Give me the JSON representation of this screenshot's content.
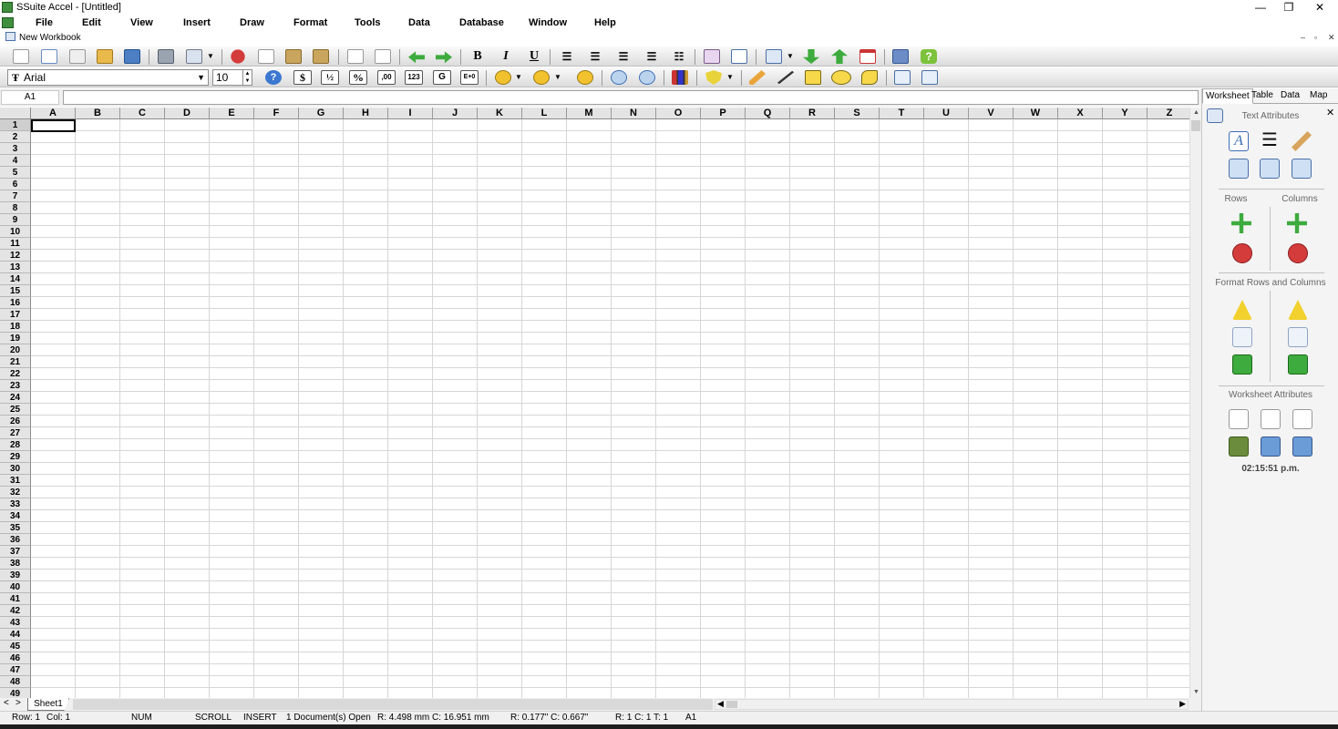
{
  "window": {
    "title": "SSuite Accel - [Untitled]",
    "controls": [
      "—",
      "❐",
      "✕"
    ]
  },
  "menu": [
    "File",
    "Edit",
    "View",
    "Insert",
    "Draw",
    "Format",
    "Tools",
    "Data",
    "Database",
    "Window",
    "Help"
  ],
  "doc_tab": {
    "label": "New Workbook",
    "controls": [
      "–",
      "▫",
      "✕"
    ]
  },
  "toolbar": {
    "font_name": "Arial",
    "font_size": "10",
    "bold": "B",
    "italic": "I",
    "underline": "U",
    "currency": "$",
    "fraction": "½",
    "percent": "%",
    "decimal": ",00",
    "number": "123",
    "general": "G",
    "scientific": "E+0"
  },
  "formula_bar": {
    "cell_ref": "A1",
    "content": ""
  },
  "grid": {
    "columns": [
      "A",
      "B",
      "C",
      "D",
      "E",
      "F",
      "G",
      "H",
      "I",
      "J",
      "K",
      "L",
      "M",
      "N",
      "O",
      "P",
      "Q",
      "R",
      "S",
      "T",
      "U",
      "V",
      "W",
      "X",
      "Y",
      "Z"
    ],
    "rows": [
      "1",
      "2",
      "3",
      "4",
      "5",
      "6",
      "7",
      "8",
      "9",
      "10",
      "11",
      "12",
      "13",
      "14",
      "15",
      "16",
      "17",
      "18",
      "19",
      "20",
      "21",
      "22",
      "23",
      "24",
      "25",
      "26",
      "27",
      "28",
      "29",
      "30",
      "31",
      "32",
      "33",
      "34",
      "35",
      "36",
      "37",
      "38",
      "39",
      "40",
      "41",
      "42",
      "43",
      "44",
      "45",
      "46",
      "47",
      "48",
      "49"
    ],
    "active_cell": "A1"
  },
  "sheets": {
    "nav_prev": "<",
    "nav_next": ">",
    "tabs": [
      "Sheet1"
    ]
  },
  "status": {
    "row": "Row:  1",
    "col": "Col:  1",
    "num": "NUM",
    "scroll": "SCROLL",
    "insert": "INSERT",
    "docs": "1 Document(s) Open",
    "mm": "R: 4.498 mm   C: 16.951 mm",
    "inch": "R: 0.177\"   C: 0.667\"",
    "rct": "R: 1   C: 1   T: 1",
    "cell": "A1"
  },
  "panel": {
    "tabs": [
      "Worksheet",
      "Table",
      "Data",
      "Map"
    ],
    "close": "✕",
    "text_attributes": "Text Attributes",
    "rows": "Rows",
    "columns": "Columns",
    "format_rows_columns": "Format Rows and Columns",
    "worksheet_attributes": "Worksheet Attributes",
    "clock": "02:15:51 p.m."
  }
}
